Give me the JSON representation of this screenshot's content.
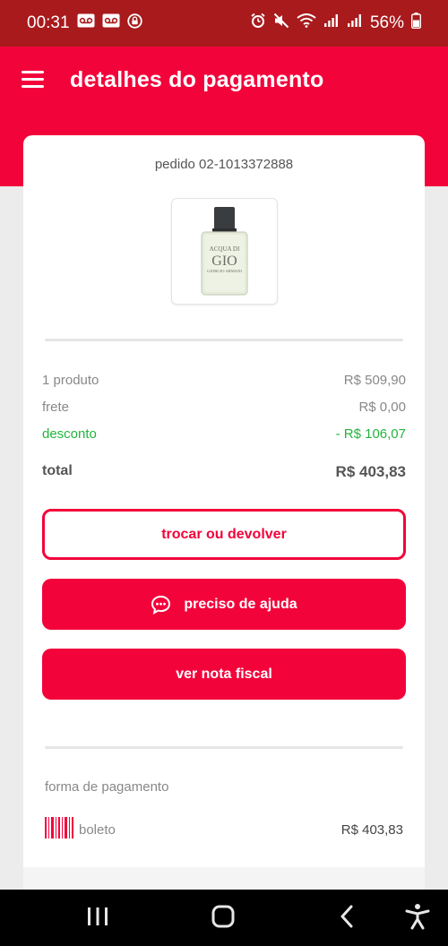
{
  "status_bar": {
    "time": "00:31",
    "battery": "56%"
  },
  "header": {
    "title": "detalhes do pagamento"
  },
  "order": {
    "number": "pedido 02-1013372888"
  },
  "summary": {
    "products_label": "1 produto",
    "products_value": "R$ 509,90",
    "shipping_label": "frete",
    "shipping_value": "R$ 0,00",
    "discount_label": "desconto",
    "discount_value": "- R$ 106,07",
    "total_label": "total",
    "total_value": "R$ 403,83"
  },
  "actions": {
    "exchange_label": "trocar ou devolver",
    "help_label": "preciso de ajuda",
    "invoice_label": "ver nota fiscal"
  },
  "payment": {
    "section_label": "forma de pagamento",
    "method": "boleto",
    "amount": "R$ 403,83"
  },
  "product_label": {
    "line1": "ACQUA DI",
    "line2": "GIO",
    "line3": "GIORGIO ARMANI"
  },
  "colors": {
    "primary": "#f2043b",
    "status_bar": "#a81a1c",
    "discount": "#22b43c"
  }
}
